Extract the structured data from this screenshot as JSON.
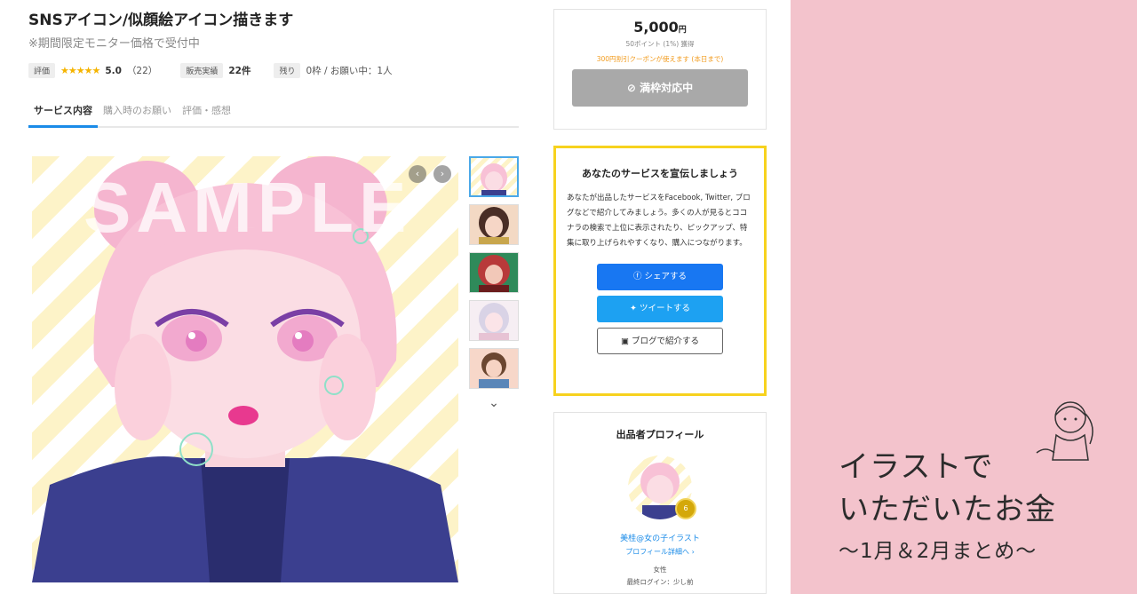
{
  "service": {
    "title": "SNSアイコン/似顔絵アイコン描きます",
    "subtitle": "※期間限定モニター価格で受付中",
    "rating_tag": "評価",
    "stars": "★★★★★",
    "rating": "5.0",
    "review_count": "（22）",
    "sales_tag": "販売実績",
    "sales_value": "22件",
    "remaining_tag": "残り",
    "remaining_value": "0枠 / お願い中：1人",
    "tabs": [
      "サービス内容",
      "購入時のお願い",
      "評価・感想"
    ],
    "watermark": "SAMPLE"
  },
  "price_box": {
    "price": "5,000",
    "currency": "円",
    "points": "50ポイント (1%) 獲得",
    "coupon": "300円割引クーポンが使えます (本日まで)",
    "button_label": "満枠対応中"
  },
  "promo": {
    "title": "あなたのサービスを宣伝しましょう",
    "text": "あなたが出品したサービスをFacebook, Twitter, ブログなどで紹介してみましょう。多くの人が見るとココナラの検索で上位に表示されたり、ピックアップ、特集に取り上げられやすくなり、購入につながります。",
    "share_facebook": "シェアする",
    "tweet": "ツイートする",
    "blog": "ブログで紹介する"
  },
  "profile": {
    "title": "出品者プロフィール",
    "medal": "6",
    "name": "美桂@女の子イラスト",
    "detail_link": "プロフィール詳細へ ›",
    "gender": "女性",
    "last_login": "最終ログイン：少し前"
  },
  "banner": {
    "line1": "イラストで",
    "line2": "いただいたお金",
    "line3": "〜1月＆2月まとめ〜"
  },
  "colors": {
    "accent": "#1a8be8",
    "star": "#f5b400",
    "coupon": "#f29b1d",
    "promo_border": "#f7d21e",
    "banner_bg": "#f3c3cc"
  }
}
